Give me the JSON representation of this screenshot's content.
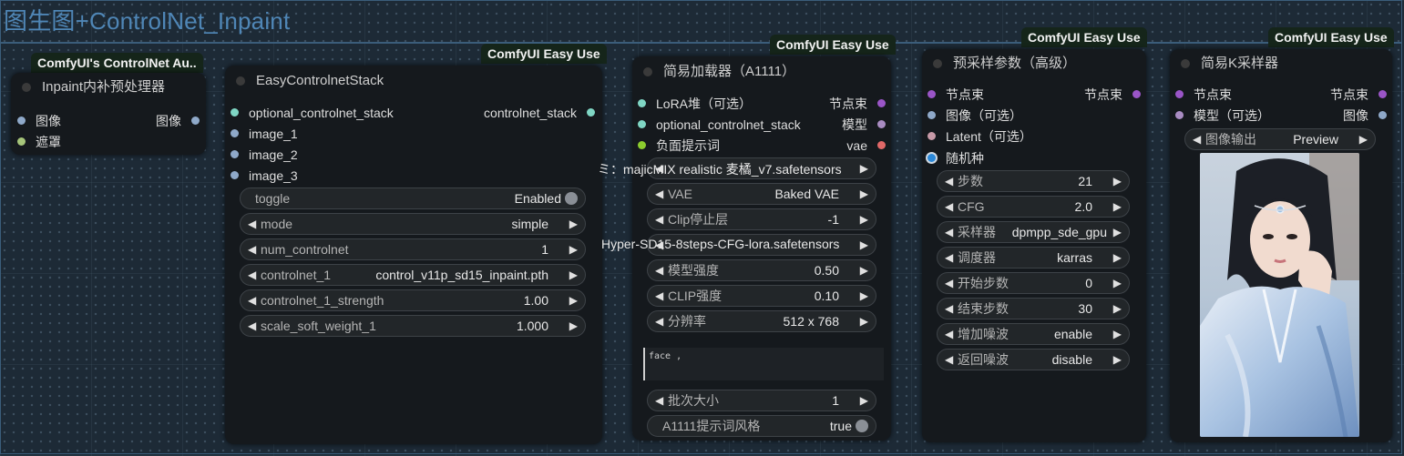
{
  "group": {
    "title": "图生图+ControlNet_Inpaint"
  },
  "nodes": {
    "inpaint": {
      "badge": "ComfyUI's ControlNet Au..",
      "title": "Inpaint内补预处理器",
      "inputs": [
        "图像",
        "遮罩"
      ],
      "outputs": [
        "图像"
      ]
    },
    "stack": {
      "badge": "ComfyUI Easy Use",
      "title": "EasyControlnetStack",
      "inputs": [
        "optional_controlnet_stack",
        "image_1",
        "image_2",
        "image_3"
      ],
      "outputs": [
        "controlnet_stack"
      ],
      "widgets": [
        {
          "label": "toggle",
          "value": "Enabled",
          "kind": "toggle"
        },
        {
          "label": "mode",
          "value": "simple",
          "kind": "combo"
        },
        {
          "label": "num_controlnet",
          "value": "1",
          "kind": "combo"
        },
        {
          "label": "controlnet_1",
          "value": "control_v11p_sd15_inpaint.pth",
          "kind": "combo"
        },
        {
          "label": "controlnet_1_strength",
          "value": "1.00",
          "kind": "number"
        },
        {
          "label": "scale_soft_weight_1",
          "value": "1.000",
          "kind": "number"
        }
      ]
    },
    "loader": {
      "badge": "ComfyUI Easy Use",
      "title": "简易加载器（A1111）",
      "inputs": [
        "LoRA堆（可选）",
        "optional_controlnet_stack",
        "负面提示词"
      ],
      "outputs": [
        "节点束",
        "模型",
        "vae"
      ],
      "widgets": [
        {
          "label": "",
          "value": "majicMIX realistic 麦橘_v7.safetensors",
          "overflow": "ミ：majicMIX realistic 麦橘_v7.safetensors",
          "kind": "combo"
        },
        {
          "label": "VAE",
          "value": "Baked VAE",
          "kind": "combo"
        },
        {
          "label": "Clip停止层",
          "value": "-1",
          "kind": "number"
        },
        {
          "label": "",
          "value": "Hyper-SD15-8steps-CFG-lora.safetensors",
          "overflow": "Hyper-SD15-8steps-CFG-lora.safetensors",
          "kind": "combo"
        },
        {
          "label": "模型强度",
          "value": "0.50",
          "kind": "number"
        },
        {
          "label": "CLIP强度",
          "value": "0.10",
          "kind": "number"
        },
        {
          "label": "分辨率",
          "value": "512 x 768",
          "kind": "combo"
        }
      ],
      "prompt_text": "face ,",
      "batch": {
        "label": "批次大小",
        "value": "1"
      },
      "style_toggle": {
        "label": "A1111提示词风格",
        "value": "true"
      }
    },
    "presampler": {
      "badge": "ComfyUI Easy Use",
      "title": "预采样参数（高级）",
      "inputs": [
        "节点束",
        "图像（可选）",
        "Latent（可选）",
        "随机种"
      ],
      "outputs": [
        "节点束"
      ],
      "widgets": [
        {
          "label": "步数",
          "value": "21"
        },
        {
          "label": "CFG",
          "value": "2.0"
        },
        {
          "label": "采样器",
          "value": "dpmpp_sde_gpu"
        },
        {
          "label": "调度器",
          "value": "karras"
        },
        {
          "label": "开始步数",
          "value": "0"
        },
        {
          "label": "结束步数",
          "value": "30"
        },
        {
          "label": "增加噪波",
          "value": "enable"
        },
        {
          "label": "返回噪波",
          "value": "disable"
        }
      ]
    },
    "ksampler": {
      "badge": "ComfyUI Easy Use",
      "title": "简易K采样器",
      "inputs": [
        "节点束",
        "模型（可选）"
      ],
      "outputs": [
        "节点束",
        "图像"
      ],
      "image_output": {
        "label": "图像输出",
        "value": "Preview"
      }
    }
  },
  "colors": {
    "pin_blue": "#8fa9c9",
    "pin_green": "#a6c57a",
    "pin_teal": "#7fd6c4",
    "pin_purple": "#9a55c7",
    "pin_lavender": "#a98cc2",
    "pin_pink": "#c79aa8",
    "pin_red": "#e06868",
    "pin_lime": "#8ccc2e",
    "pin_seed": "#2b88d8"
  }
}
